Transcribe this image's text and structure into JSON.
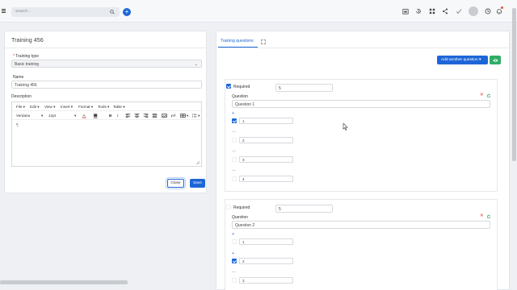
{
  "topbar": {
    "search_placeholder": "Search...",
    "add_label": "+"
  },
  "left": {
    "title": "Training 456",
    "type_label": "Training type",
    "type_required_mark": "*",
    "type_value": "Basic training",
    "name_label": "Name",
    "name_value": "Training 456",
    "description_label": "Description",
    "editor": {
      "menus": [
        "File",
        "Edit",
        "View",
        "Insert",
        "Format",
        "Tools",
        "Table"
      ],
      "font": "Verdana",
      "size": "12pt",
      "content": "¶"
    },
    "close_label": "Close",
    "save_label": "Save"
  },
  "right": {
    "tab_label": "Training questions",
    "add_label": "Add another question",
    "questions": [
      {
        "required_label": "Required",
        "required_checked": true,
        "points": "5",
        "question_label": "Question",
        "question_value": "Question 1",
        "answers": [
          {
            "value": "1",
            "checked": true,
            "prefix": "+"
          },
          {
            "value": "2",
            "checked": false,
            "prefix": "—"
          },
          {
            "value": "3",
            "checked": false,
            "prefix": "—"
          },
          {
            "value": "4",
            "checked": false,
            "prefix": "—"
          }
        ]
      },
      {
        "required_label": "Required",
        "required_checked": false,
        "points": "5",
        "question_label": "Question",
        "question_value": "Question 2",
        "answers": [
          {
            "value": "1",
            "checked": false,
            "prefix": "+"
          },
          {
            "value": "2",
            "checked": true,
            "prefix": "+"
          },
          {
            "value": "3",
            "checked": false,
            "prefix": "—"
          }
        ]
      }
    ]
  },
  "colors": {
    "accent": "#1d66d8",
    "danger": "#d93025",
    "success": "#2eae66"
  },
  "icons": [
    "menu-icon",
    "search-icon",
    "plus-icon",
    "calendar-icon",
    "history-icon",
    "apps-icon",
    "share-icon",
    "check-icon",
    "clock-icon",
    "bell-icon",
    "expand-icon",
    "eye-icon",
    "close-icon",
    "refresh-icon"
  ]
}
